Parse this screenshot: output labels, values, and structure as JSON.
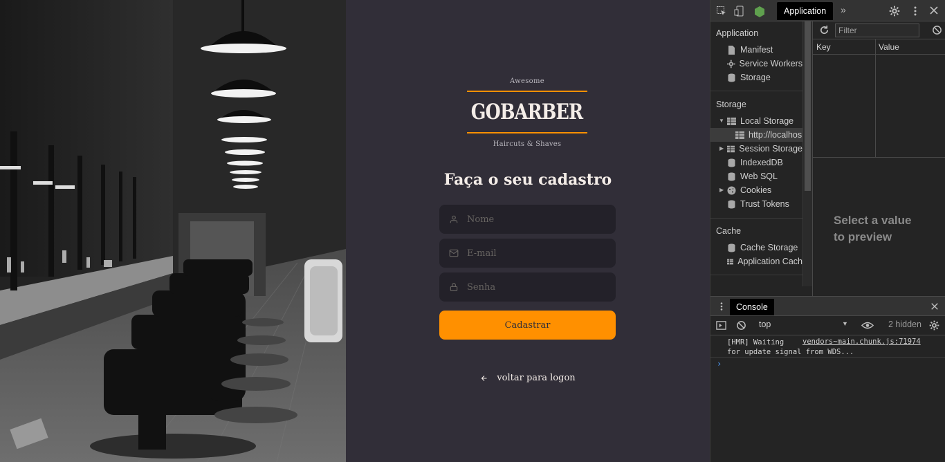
{
  "logo": {
    "top": "Awesome",
    "wordmark": "GOBARBER",
    "bottom": "Haircuts & Shaves"
  },
  "form": {
    "title": "Faça o seu cadastro",
    "name_placeholder": "Nome",
    "email_placeholder": "E-mail",
    "password_placeholder": "Senha",
    "submit_label": "Cadastrar",
    "back_label": "voltar para logon"
  },
  "colors": {
    "accent": "#ff9000",
    "background": "#312e38",
    "input_bg": "#232129",
    "text": "#f4ede8",
    "placeholder": "#666360"
  },
  "devtools": {
    "active_tab": "Application",
    "more_icon": "chevron-double-right-icon",
    "sidebar": {
      "application_header": "Application",
      "application_items": [
        "Manifest",
        "Service Workers",
        "Storage"
      ],
      "storage_header": "Storage",
      "local_storage": "Local Storage",
      "local_storage_origin": "http://localhos",
      "storage_items": [
        "Session Storage",
        "IndexedDB",
        "Web SQL",
        "Cookies",
        "Trust Tokens"
      ],
      "cache_header": "Cache",
      "cache_items": [
        "Cache Storage",
        "Application Cach"
      ]
    },
    "filter_placeholder": "Filter",
    "table_headers": {
      "key": "Key",
      "value": "Value"
    },
    "preview_line1": "Select a value",
    "preview_line2": "to preview",
    "console": {
      "tab": "Console",
      "context": "top",
      "hidden_count": "2 hidden",
      "log_message": "[HMR] Waiting\nfor update signal from WDS...",
      "log_source": "vendors~main.chunk.js:71974",
      "prompt": "›"
    }
  }
}
